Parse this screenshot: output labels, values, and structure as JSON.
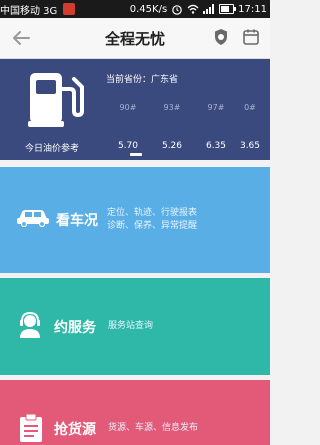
{
  "status_bar": {
    "carrier": "中国移动 3G",
    "speed": "0.45K/s",
    "time": "17:11"
  },
  "header": {
    "title": "全程无忧"
  },
  "fuel": {
    "province_label": "当前省份：广东省",
    "today_label": "今日油价参考",
    "types": [
      "90#",
      "93#",
      "97#",
      "0#"
    ],
    "prices": [
      "5.70",
      "5.26",
      "6.35",
      "3.65"
    ]
  },
  "tiles": [
    {
      "title": "看车况",
      "desc_line1": "定位、轨迹、行驶报表",
      "desc_line2": "诊断、保养、异常提醒"
    },
    {
      "title": "约服务",
      "desc_line1": "服务站查询"
    },
    {
      "title": "抢货源",
      "desc_line1": "货源、车源、信息发布"
    }
  ],
  "colors": {
    "fuel_bg": "#3b4a7e",
    "tile1": "#5aaee6",
    "tile2": "#2fb8a8",
    "tile3": "#e35a79"
  }
}
